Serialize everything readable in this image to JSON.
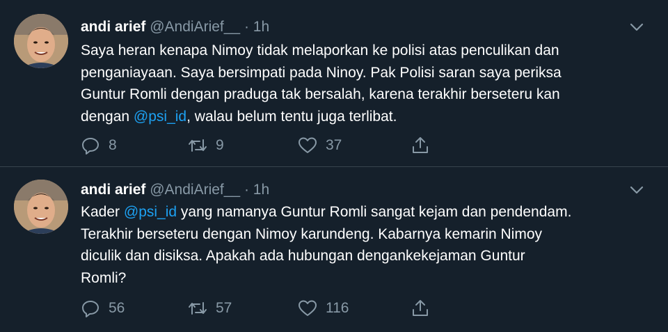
{
  "tweets": [
    {
      "name": "andi arief",
      "handle": "@AndiArief__",
      "dot": "·",
      "time": "1h",
      "text_parts": [
        "Saya heran kenapa Nimoy tidak melaporkan ke polisi atas penculikan dan\npenganiayaan. Saya bersimpati pada Ninoy. Pak Polisi saran saya periksa\nGuntur Romli dengan praduga tak bersalah, karena terakhir berseteru kan\ndengan ",
        "@psi_id",
        ", walau belum tentu juga terlibat."
      ],
      "reply_count": "8",
      "retweet_count": "9",
      "like_count": "37"
    },
    {
      "name": "andi arief",
      "handle": "@AndiArief__",
      "dot": "·",
      "time": "1h",
      "text_parts": [
        "Kader ",
        "@psi_id",
        " yang namanya Guntur Romli sangat kejam dan pendendam.\nTerakhir berseteru dengan Nimoy karundeng.  Kabarnya kemarin Nimoy\ndiculik dan disiksa. Apakah ada hubungan dengankekejaman Guntur\nRomli?"
      ],
      "reply_count": "56",
      "retweet_count": "57",
      "like_count": "116"
    }
  ],
  "icons": {
    "reply": "reply-icon",
    "retweet": "retweet-icon",
    "like": "heart-icon",
    "share": "share-icon",
    "caret": "chevron-down-icon"
  },
  "colors": {
    "background": "#15202b",
    "divider": "#38444d",
    "secondary_text": "#8899a6",
    "link": "#1da1f2"
  }
}
